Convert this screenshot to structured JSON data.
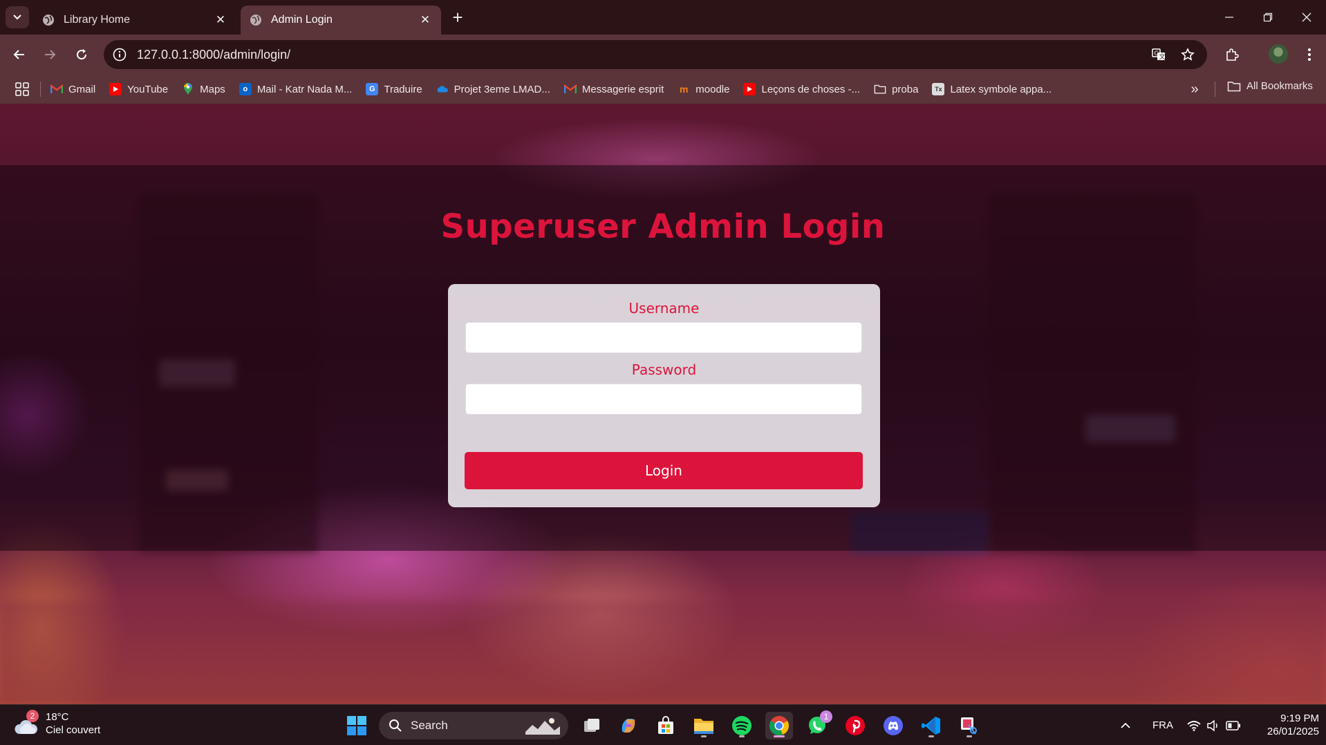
{
  "browser": {
    "tabs": [
      {
        "title": "Library Home",
        "active": false
      },
      {
        "title": "Admin Login",
        "active": true
      }
    ],
    "url": "127.0.0.1:8000/admin/login/",
    "bookmarks": [
      {
        "label": "Gmail",
        "icon": "gmail-icon",
        "color": "#ea4335"
      },
      {
        "label": "YouTube",
        "icon": "youtube-icon",
        "color": "#ff0000"
      },
      {
        "label": "Maps",
        "icon": "maps-icon",
        "color": "#34a853"
      },
      {
        "label": "Mail - Katr Nada M...",
        "icon": "outlook-icon",
        "color": "#0a64c8"
      },
      {
        "label": "Traduire",
        "icon": "translate-icon",
        "color": "#4285f4"
      },
      {
        "label": "Projet 3eme LMAD...",
        "icon": "onedrive-icon",
        "color": "#1e88e5"
      },
      {
        "label": "Messagerie esprit",
        "icon": "gmail-icon",
        "color": "#ea4335"
      },
      {
        "label": "moodle",
        "icon": "moodle-icon",
        "color": "#f98012"
      },
      {
        "label": "Leçons de choses -...",
        "icon": "youtube-icon",
        "color": "#ff0000"
      },
      {
        "label": "proba",
        "icon": "folder-icon",
        "color": "#f0e6e7"
      },
      {
        "label": "Latex symbole appa...",
        "icon": "latex-icon",
        "color": "#dddddd"
      }
    ],
    "all_bookmarks": "All Bookmarks"
  },
  "page": {
    "title": "Superuser Admin Login",
    "username_label": "Username",
    "username_value": "",
    "password_label": "Password",
    "password_value": "",
    "login_button": "Login",
    "accent_color": "#dc143c"
  },
  "taskbar": {
    "weather_badge": "2",
    "temperature": "18°C",
    "weather_desc": "Ciel couvert",
    "search_label": "Search",
    "apps": [
      "task-view-icon",
      "copilot-icon",
      "store-icon",
      "file-explorer-icon",
      "spotify-icon",
      "chrome-icon",
      "whatsapp-icon",
      "pinterest-icon",
      "discord-icon",
      "vscode-icon",
      "snipping-tool-icon"
    ],
    "whatsapp_badge": "1",
    "language": "FRA",
    "time": "9:19 PM",
    "date": "26/01/2025"
  }
}
